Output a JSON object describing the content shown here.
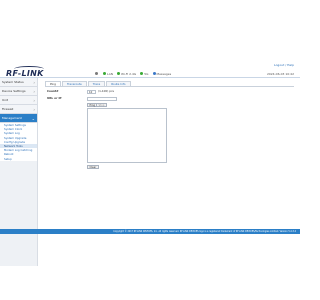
{
  "header": {
    "logo_text": "RF-LINK",
    "status": [
      {
        "icon": "wired-icon",
        "label": "",
        "color": "#7a7a7a"
      },
      {
        "icon": "lan-icon",
        "label": "LAN",
        "color": "#3aaa35"
      },
      {
        "icon": "wifi-icon",
        "label": "Wi-Fi 2.4G",
        "color": "#3aaa35"
      },
      {
        "icon": "wifi-5g-icon",
        "label": "5G",
        "color": "#3aaa35"
      },
      {
        "icon": "message-icon",
        "label": "Messages",
        "color": "#3a78c8"
      }
    ],
    "logout": "Logout / Help",
    "datetime": "2024-06-03 10:42"
  },
  "sidebar": {
    "items": [
      {
        "label": "System Status",
        "active": false
      },
      {
        "label": "Device Settings",
        "active": false
      },
      {
        "label": "Unit",
        "active": false
      },
      {
        "label": "Firewall",
        "active": false
      },
      {
        "label": "Management",
        "active": true
      }
    ],
    "sub_items": [
      {
        "label": "System Settings",
        "active": false
      },
      {
        "label": "System Clock",
        "active": false
      },
      {
        "label": "System Log",
        "active": false
      },
      {
        "label": "System Upgrade",
        "active": false
      },
      {
        "label": "Config Upgrade",
        "active": false
      },
      {
        "label": "Network Tools",
        "active": true
      },
      {
        "label": "Modem Log Catching",
        "active": false
      },
      {
        "label": "Reboot",
        "active": false
      },
      {
        "label": "Setup",
        "active": false
      }
    ]
  },
  "tabs": [
    {
      "label": "Ping",
      "active": true
    },
    {
      "label": "Traceroute",
      "active": false
    },
    {
      "label": "Trace",
      "active": false
    },
    {
      "label": "Route Info",
      "active": false
    }
  ],
  "form": {
    "count_label": "Count#",
    "count_value": "10",
    "count_unit": "(1-100) pcs",
    "url_label": "URL or IP",
    "url_value": "",
    "ping_button": "Ping",
    "stop_button": "Stop",
    "clear_button": "Clear"
  },
  "footer": {
    "text": "Copyright © 2017 RF-LINK DEVICES, Inc. All rights reserved. RF-LINK DEVICES logo is a registered trademark of RF-LINK DEVICES/Technologies Limited. Version 5.4.3.2"
  }
}
